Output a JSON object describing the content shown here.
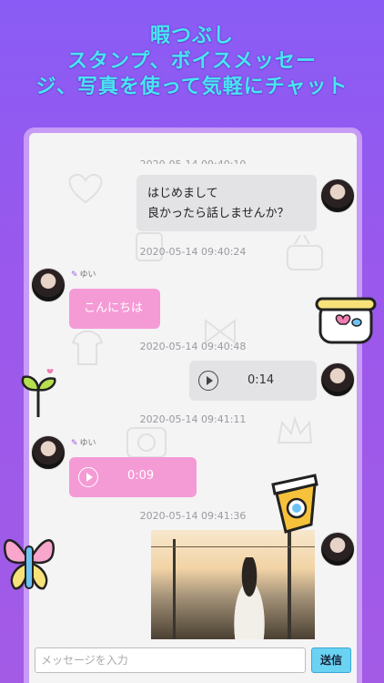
{
  "headline": {
    "lines": [
      "暇つぶし",
      "スタンプ、ボイスメッセー",
      "ジ、写真を使って気軽にチャット"
    ]
  },
  "chat": {
    "top_timestamp_partial": "2020-05-14 09:40:10",
    "messages": [
      {
        "side": "right",
        "type": "text",
        "line1": "はじめまして",
        "line2": "良かったら話しませんか？"
      },
      {
        "type": "timestamp",
        "text": "2020-05-14 09:40:24"
      },
      {
        "side": "left",
        "type": "text",
        "sender": "ゆい",
        "text": "こんにちは"
      },
      {
        "type": "timestamp",
        "text": "2020-05-14 09:40:48"
      },
      {
        "side": "right",
        "type": "voice",
        "duration": "0:14"
      },
      {
        "type": "timestamp",
        "text": "2020-05-14 09:41:11"
      },
      {
        "side": "left",
        "type": "voice",
        "sender": "ゆい",
        "duration": "0:09"
      },
      {
        "type": "timestamp",
        "text": "2020-05-14 09:41:36"
      },
      {
        "side": "right",
        "type": "image"
      }
    ]
  },
  "composer": {
    "placeholder": "メッセージを入力",
    "send_label": "送信"
  },
  "colors": {
    "background": "#9a58ec",
    "headline": "#48e6f2",
    "pink_bubble": "#f49bd6",
    "gray_bubble": "#e3e3e6",
    "send_button": "#6ad3f2"
  }
}
